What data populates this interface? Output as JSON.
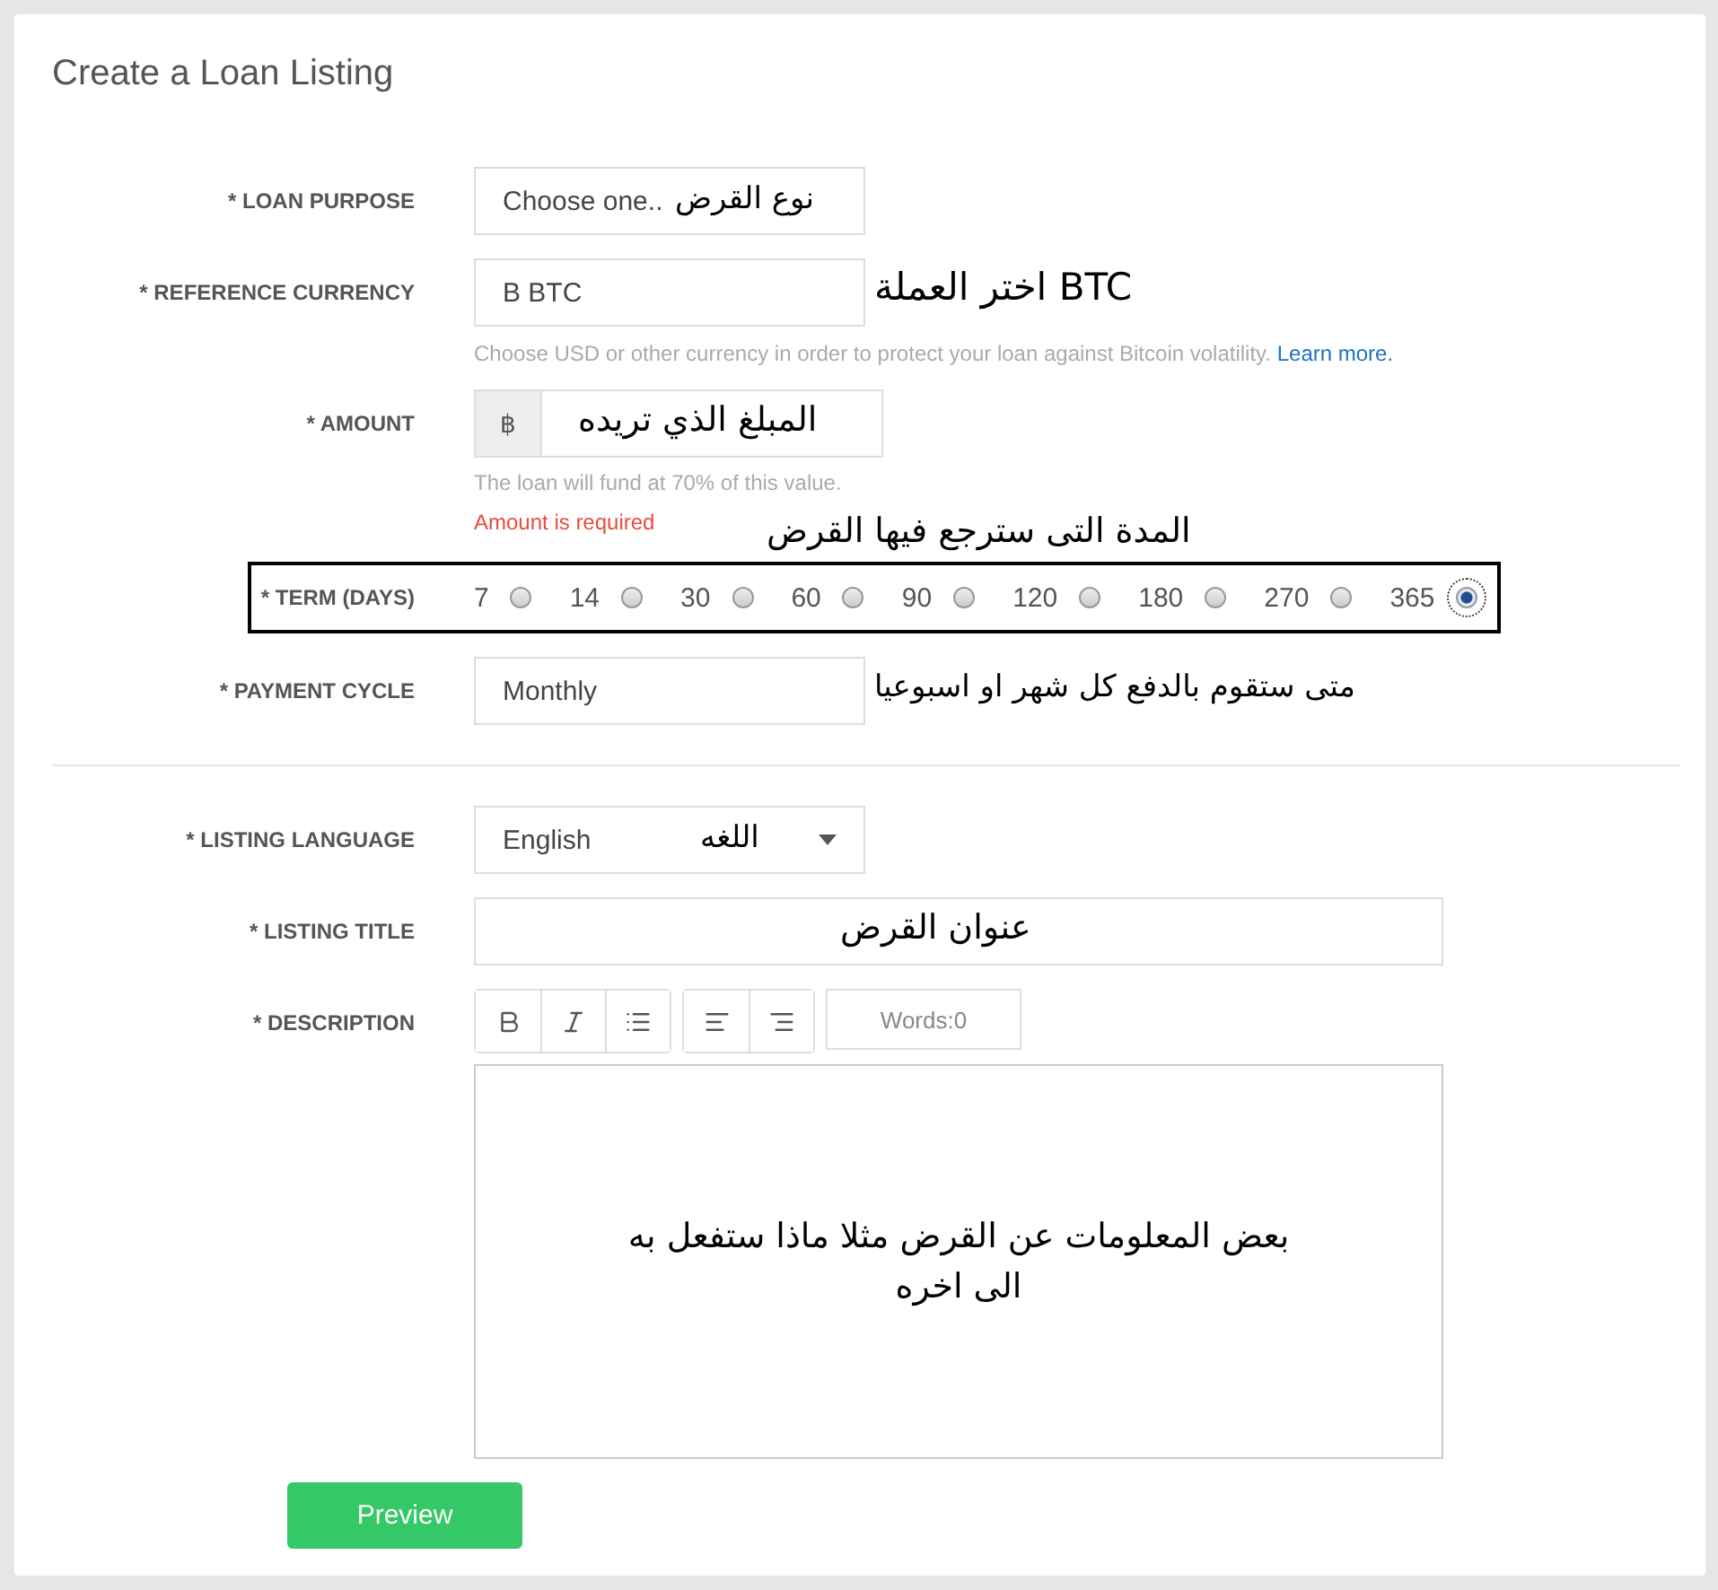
{
  "title": "Create a Loan Listing",
  "section_1": [
    {
      "kind": "select",
      "label": "* LOAN PURPOSE",
      "value": "Choose one..",
      "caret": false,
      "annotation": "نوع القرض"
    },
    {
      "kind": "select",
      "label": "* REFERENCE CURRENCY",
      "value": "B BTC",
      "caret": false,
      "annotation": "اختر العملة BTC",
      "help": "Choose USD or other currency in order to protect your loan against Bitcoin volatility.",
      "help_link": "Learn more."
    },
    {
      "kind": "addon",
      "label": "* AMOUNT",
      "addon": "฿",
      "annotation": "المبلغ الذي تريده",
      "help": "The loan will fund at 70% of this value.",
      "error": "Amount is required"
    },
    {
      "kind": "radios",
      "label": "* TERM (DAYS)",
      "highlighted": true,
      "annotation": "المدة التى سترجع فيها القرض",
      "options": [
        {
          "label": "7",
          "selected": false
        },
        {
          "label": "14",
          "selected": false
        },
        {
          "label": "30",
          "selected": false
        },
        {
          "label": "60",
          "selected": false
        },
        {
          "label": "90",
          "selected": false
        },
        {
          "label": "120",
          "selected": false
        },
        {
          "label": "180",
          "selected": false
        },
        {
          "label": "270",
          "selected": false
        },
        {
          "label": "365",
          "selected": true
        }
      ]
    },
    {
      "kind": "select",
      "label": "* PAYMENT CYCLE",
      "value": "Monthly",
      "caret": false,
      "annotation": "متى ستقوم بالدفع كل شهر او اسبوعيا"
    }
  ],
  "section_2": [
    {
      "kind": "select",
      "label": "* LISTING LANGUAGE",
      "value": "English",
      "caret": true,
      "annotation": "اللغه"
    },
    {
      "kind": "text",
      "label": "* LISTING TITLE",
      "annotation": "عنوان القرض"
    },
    {
      "kind": "editor",
      "label": "* DESCRIPTION",
      "word_count": "Words:0",
      "annotation": "بعض المعلومات عن القرض مثلا ماذا ستفعل به الى اخره"
    }
  ],
  "preview_button": "Preview"
}
